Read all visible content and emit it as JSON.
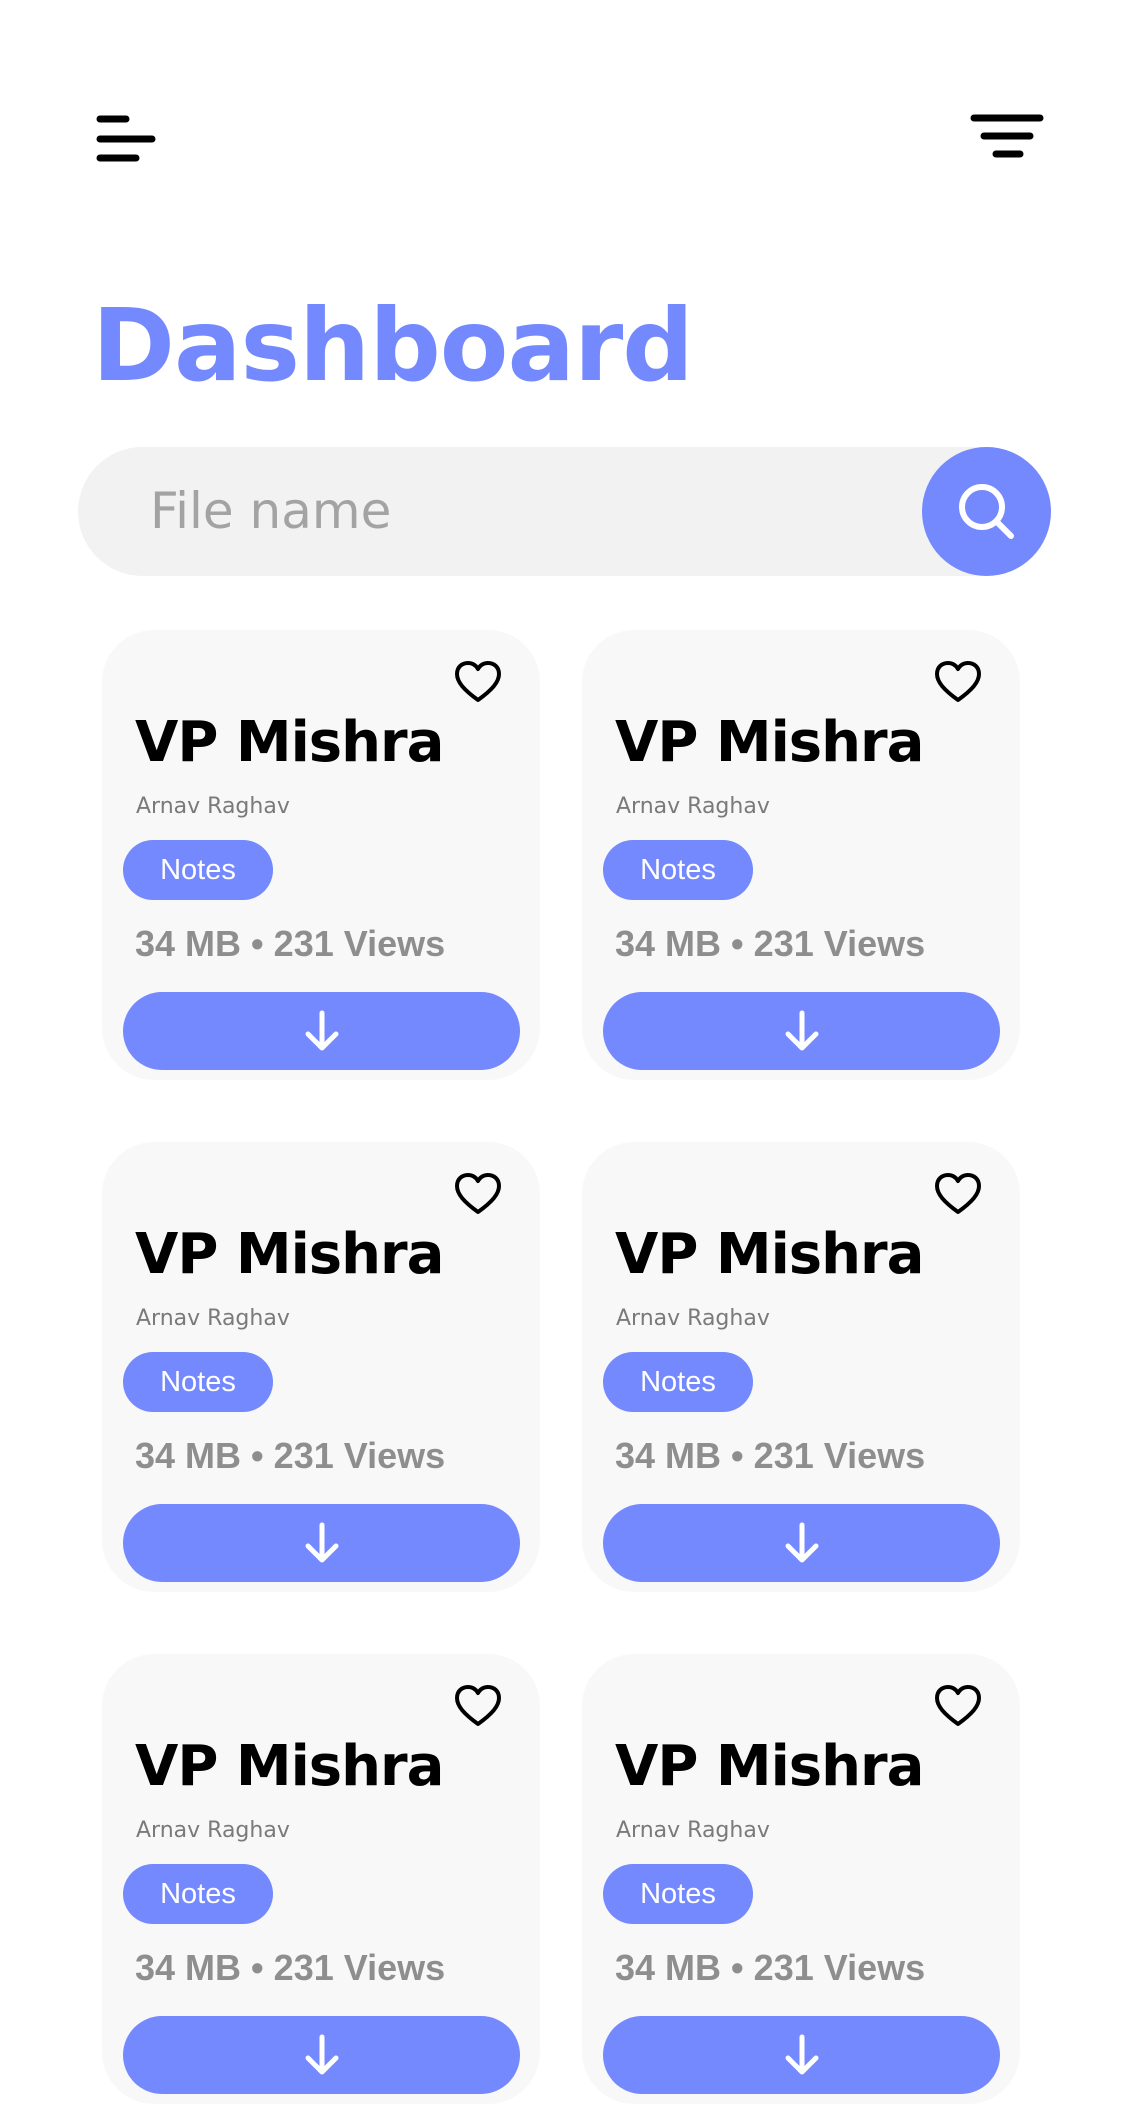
{
  "header": {
    "menu_icon": "menu-icon",
    "filter_icon": "filter-icon",
    "title": "Dashboard"
  },
  "search": {
    "placeholder": "File name",
    "value": "",
    "icon": "search-icon"
  },
  "colors": {
    "accent": "#7489fd",
    "card_bg": "#f8f8f8",
    "search_bg": "#f2f2f2",
    "muted_text": "#8e8e8e"
  },
  "cards": [
    {
      "title": "VP Mishra",
      "author": "Arnav Raghav",
      "tag": "Notes",
      "size": "34 MB",
      "separator": "•",
      "views": "231 Views"
    },
    {
      "title": "VP Mishra",
      "author": "Arnav Raghav",
      "tag": "Notes",
      "size": "34 MB",
      "separator": "•",
      "views": "231 Views"
    },
    {
      "title": "VP Mishra",
      "author": "Arnav Raghav",
      "tag": "Notes",
      "size": "34 MB",
      "separator": "•",
      "views": "231 Views"
    },
    {
      "title": "VP Mishra",
      "author": "Arnav Raghav",
      "tag": "Notes",
      "size": "34 MB",
      "separator": "•",
      "views": "231 Views"
    },
    {
      "title": "VP Mishra",
      "author": "Arnav Raghav",
      "tag": "Notes",
      "size": "34 MB",
      "separator": "•",
      "views": "231 Views"
    },
    {
      "title": "VP Mishra",
      "author": "Arnav Raghav",
      "tag": "Notes",
      "size": "34 MB",
      "separator": "•",
      "views": "231 Views"
    }
  ]
}
